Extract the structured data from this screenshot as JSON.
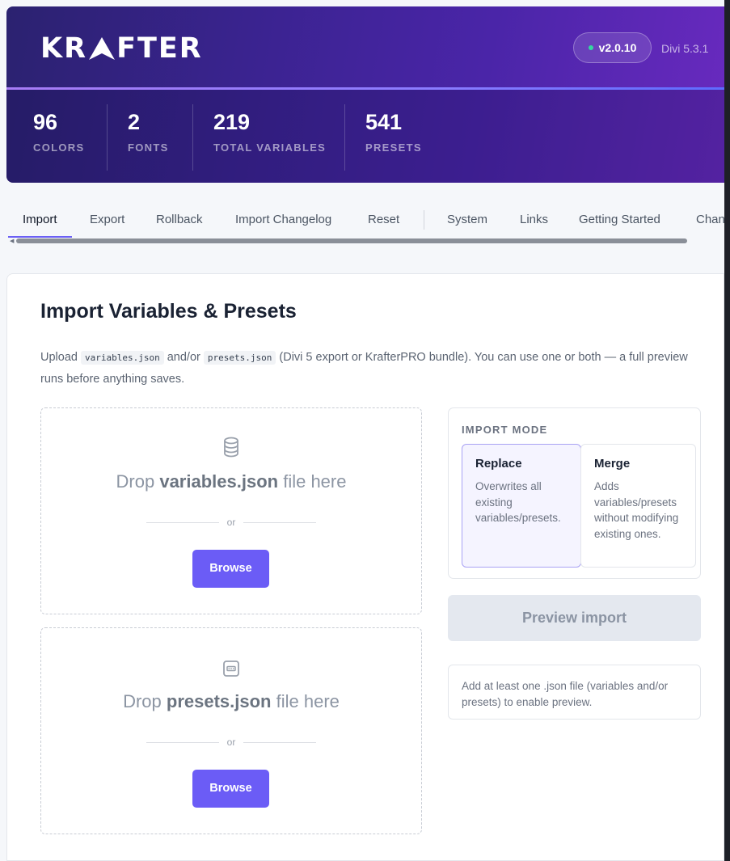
{
  "header": {
    "logo_text_left": "KR",
    "logo_text_right": "FTER",
    "version": "v2.0.10",
    "divi_version": "Divi 5.3.1"
  },
  "stats": [
    {
      "value": "96",
      "label": "COLORS"
    },
    {
      "value": "2",
      "label": "FONTS"
    },
    {
      "value": "219",
      "label": "TOTAL VARIABLES"
    },
    {
      "value": "541",
      "label": "PRESETS"
    }
  ],
  "tabs": [
    {
      "label": "Import",
      "active": true
    },
    {
      "label": "Export"
    },
    {
      "label": "Rollback"
    },
    {
      "label": "Import Changelog"
    },
    {
      "label": "Reset"
    },
    {
      "label": "System"
    },
    {
      "label": "Links"
    },
    {
      "label": "Getting Started"
    },
    {
      "label": "Changelog"
    }
  ],
  "main": {
    "title": "Import Variables & Presets",
    "desc_prefix": "Upload",
    "desc_code1": "variables.json",
    "desc_mid": "and/or",
    "desc_code2": "presets.json",
    "desc_suffix": "(Divi 5 export or KrafterPRO bundle). You can use one or both — a full preview runs before anything saves.",
    "dropzones": [
      {
        "pre": "Drop",
        "file": "variables.json",
        "post": "file here",
        "or": "or",
        "button": "Browse",
        "icon": "database-icon"
      },
      {
        "pre": "Drop",
        "file": "presets.json",
        "post": "file here",
        "or": "or",
        "button": "Browse",
        "icon": "presets-icon"
      }
    ],
    "import_mode": {
      "heading": "IMPORT MODE",
      "options": [
        {
          "name": "Replace",
          "desc": "Overwrites all existing variables/presets.",
          "selected": true
        },
        {
          "name": "Merge",
          "desc": "Adds variables/presets without modifying existing ones.",
          "selected": false
        }
      ]
    },
    "preview_button": "Preview import",
    "hint": "Add at least one .json file (variables and/or presets) to enable preview."
  },
  "colors": {
    "accent": "#6b5cf6",
    "header_start": "#2b2270",
    "header_end": "#6a2ac0",
    "status_dot": "#35d6a0"
  }
}
